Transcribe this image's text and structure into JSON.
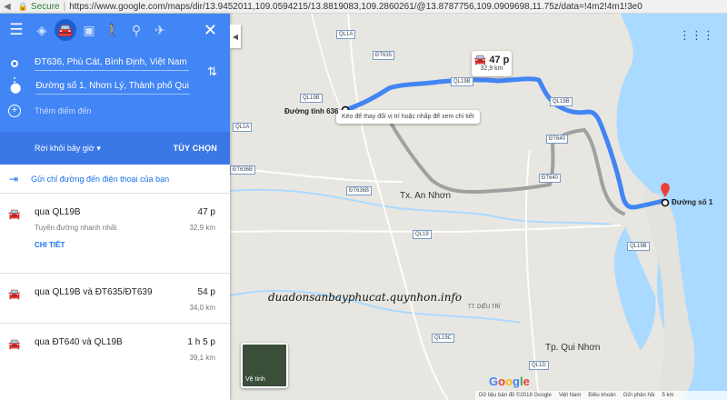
{
  "browser": {
    "secure_label": "Secure",
    "url": "https://www.google.com/maps/dir/13.9452011,109.0594215/13.8819083,109.2860261/@13.8787756,109.0909698,11.75z/data=!4m2!4m1!3e0"
  },
  "directions": {
    "origin": "ĐT636, Phù Cát, Bình Định, Việt Nam",
    "destination": "Đường số 1, Nhơn Lý, Thành phố Qui Nhơn",
    "add_destination": "Thêm điểm đến",
    "leave_now": "Rời khỏi bây giờ",
    "options": "TÙY CHỌN",
    "send_to_phone": "Gửi chỉ đường đến điện thoại của bạn",
    "routes": [
      {
        "name": "qua QL19B",
        "duration": "47 p",
        "note": "Tuyến đường nhanh nhất",
        "distance": "32,9 km",
        "details": "CHI TIẾT"
      },
      {
        "name": "qua QL19B và ĐT635/ĐT639",
        "duration": "54 p",
        "distance": "34,0 km"
      },
      {
        "name": "qua ĐT640 và QL19B",
        "duration": "1 h 5 p",
        "distance": "39,1 km"
      }
    ]
  },
  "map": {
    "route_time": "47 p",
    "route_distance": "32,9 km",
    "start_label": "Đường tỉnh 636",
    "end_label": "Đường số 1",
    "drag_hint": "Kéo để thay đổi vị trí hoặc nhấp để xem chi tiết",
    "places": {
      "an_nhon": "Tx. An Nhơn",
      "qui_nhon": "Tp. Qui Nhơn",
      "dieu_tri": "TT. DIÊU TRÌ"
    },
    "road_shields": [
      "QL1A",
      "ĐT635",
      "QL19B",
      "QL19B",
      "QL19B",
      "ĐT640",
      "ĐT640",
      "ĐT636B",
      "ĐT636B",
      "QL19",
      "QL19C",
      "QL1D",
      "QL19B",
      "QL1A"
    ],
    "satellite": "Vệ tinh",
    "watermark": "duadonsanbayphucat.quynhon.info",
    "google_logo": "Google",
    "footer": [
      "Dữ liệu bản đồ ©2018 Google",
      "Việt Nam",
      "Điều khoản",
      "Gửi phản hồi",
      "5 km"
    ],
    "colors": {
      "route": "#4285f4",
      "alt_route": "#a0a0a0",
      "water": "#aadaff",
      "land": "#e8e6e1"
    }
  }
}
